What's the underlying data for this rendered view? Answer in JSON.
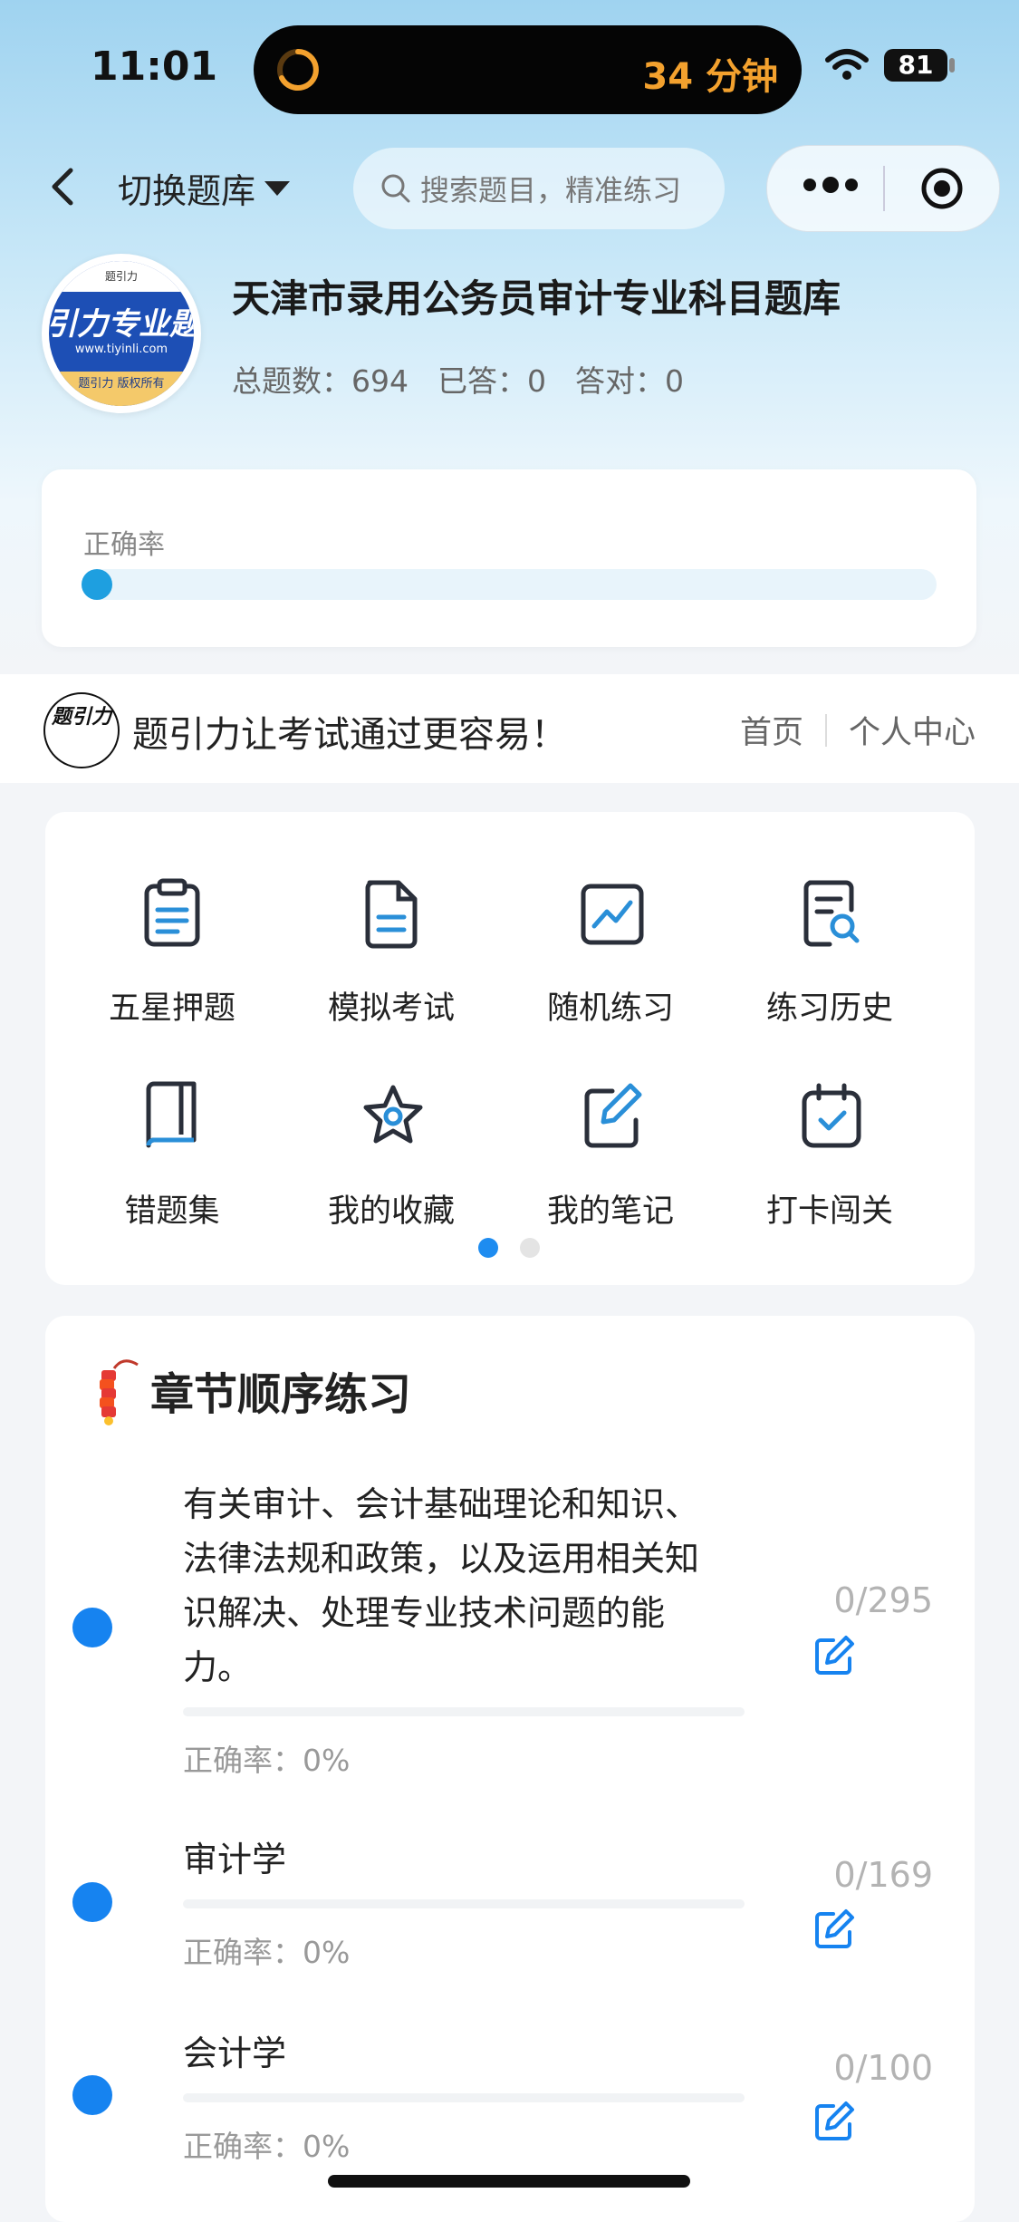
{
  "status_bar": {
    "time": "11:01",
    "timer": "34 分钟",
    "battery": "81"
  },
  "nav": {
    "switch_label": "切换题库",
    "search_placeholder": "搜索题目，精准练习"
  },
  "bank": {
    "logo_main": "引力专业题",
    "logo_top": "题引力",
    "logo_url": "www.tiyinli.com",
    "logo_sub": "题引力 版权所有",
    "title": "天津市录用公务员审计专业科目题库",
    "total": "总题数：694",
    "answered": "已答：0",
    "correct": "答对：0"
  },
  "accuracy": {
    "label": "正确率",
    "value_fraction": 0
  },
  "slogan": {
    "logo_text": "题引力",
    "text": "题引力让考试通过更容易！",
    "home": "首页",
    "personal": "个人中心"
  },
  "menu": {
    "items": [
      {
        "label": "五星押题",
        "icon": "clipboard-list-icon"
      },
      {
        "label": "模拟考试",
        "icon": "document-icon"
      },
      {
        "label": "随机练习",
        "icon": "line-chart-icon"
      },
      {
        "label": "练习历史",
        "icon": "document-search-icon"
      },
      {
        "label": "错题集",
        "icon": "book-icon"
      },
      {
        "label": "我的收藏",
        "icon": "star-icon"
      },
      {
        "label": "我的笔记",
        "icon": "edit-note-icon"
      },
      {
        "label": "打卡闯关",
        "icon": "calendar-check-icon"
      }
    ],
    "page_dots": {
      "current": 1,
      "total": 2
    }
  },
  "chapters": {
    "title": "章节顺序练习",
    "items": [
      {
        "name": "有关审计、会计基础理论和知识、法律法规和政策，以及运用相关知识解决、处理专业技术问题的能力。",
        "rate": "正确率：0%",
        "count": "0/295"
      },
      {
        "name": "审计学",
        "rate": "正确率：0%",
        "count": "0/169"
      },
      {
        "name": "会计学",
        "rate": "正确率：0%",
        "count": "0/100"
      }
    ]
  },
  "colors": {
    "accent": "#1683f0",
    "progress": "#1e9fe0",
    "timer": "#f3a12e"
  }
}
